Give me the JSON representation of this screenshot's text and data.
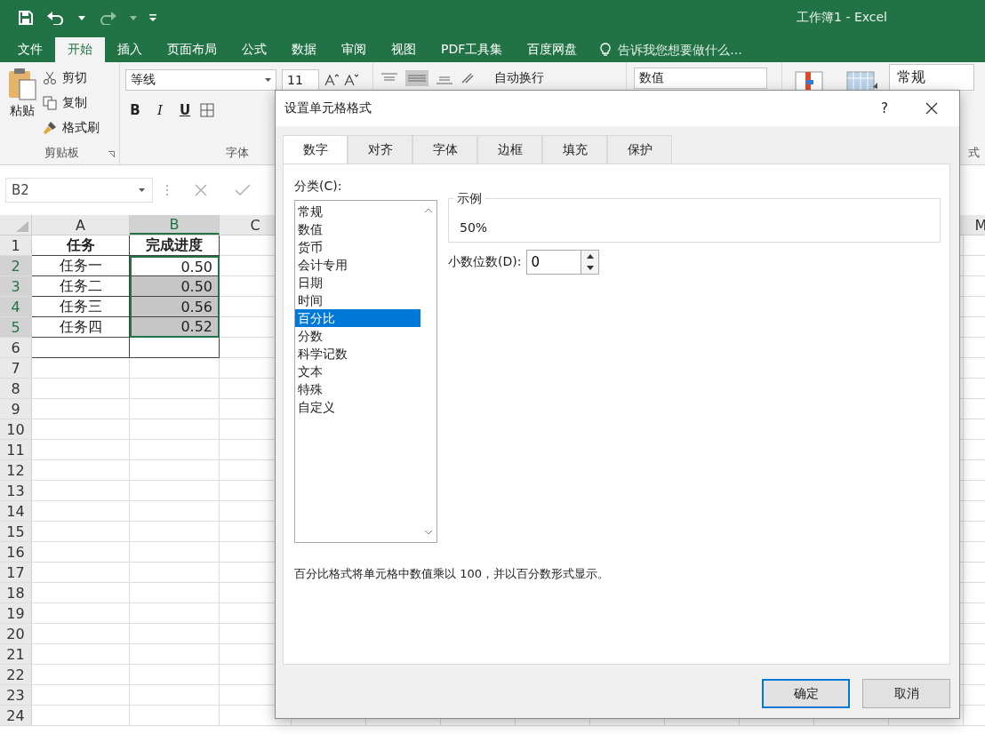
{
  "window": {
    "title": "工作簿1 - Excel"
  },
  "menu_tabs": [
    {
      "label": "文件",
      "selected": false
    },
    {
      "label": "开始",
      "selected": true
    },
    {
      "label": "插入",
      "selected": false
    },
    {
      "label": "页面布局",
      "selected": false
    },
    {
      "label": "公式",
      "selected": false
    },
    {
      "label": "数据",
      "selected": false
    },
    {
      "label": "审阅",
      "selected": false
    },
    {
      "label": "视图",
      "selected": false
    },
    {
      "label": "PDF工具集",
      "selected": false
    },
    {
      "label": "百度网盘",
      "selected": false
    }
  ],
  "tell_me": {
    "placeholder": "告诉我您想要做什么..."
  },
  "ribbon": {
    "paste": "粘贴",
    "cut": "剪切",
    "copy": "复制",
    "format_painter": "格式刷",
    "clipboard_label": "剪贴板",
    "font_name": "等线",
    "font_size": "11",
    "format_buttons": [
      "B",
      "I",
      "U"
    ],
    "font_label": "字体",
    "wrap_text": "自动换行",
    "number_format": "数值",
    "cell_style": "常规",
    "styles_label": "式"
  },
  "formula_bar": {
    "name_box": "B2"
  },
  "sheet": {
    "columns": [
      {
        "label": "A",
        "selected": false
      },
      {
        "label": "B",
        "selected": true
      },
      {
        "label": "C",
        "selected": false
      },
      {
        "label": "M",
        "selected": false
      }
    ],
    "rows": [
      {
        "number": "1",
        "selected": false,
        "bordered": true,
        "cells": [
          {
            "text": "任务",
            "kind": "header",
            "selected": false,
            "active": false
          },
          {
            "text": "完成进度",
            "kind": "header",
            "selected": false,
            "active": false
          }
        ]
      },
      {
        "number": "2",
        "selected": true,
        "bordered": true,
        "cells": [
          {
            "text": "任务一",
            "kind": "text",
            "selected": false,
            "active": false
          },
          {
            "text": "0.50",
            "kind": "number",
            "selected": true,
            "active": true
          }
        ]
      },
      {
        "number": "3",
        "selected": true,
        "bordered": true,
        "cells": [
          {
            "text": "任务二",
            "kind": "text",
            "selected": false,
            "active": false
          },
          {
            "text": "0.50",
            "kind": "number",
            "selected": true,
            "active": false
          }
        ]
      },
      {
        "number": "4",
        "selected": true,
        "bordered": true,
        "cells": [
          {
            "text": "任务三",
            "kind": "text",
            "selected": false,
            "active": false
          },
          {
            "text": "0.56",
            "kind": "number",
            "selected": true,
            "active": false
          }
        ]
      },
      {
        "number": "5",
        "selected": true,
        "bordered": true,
        "cells": [
          {
            "text": "任务四",
            "kind": "text",
            "selected": false,
            "active": false
          },
          {
            "text": "0.52",
            "kind": "number",
            "selected": true,
            "active": false
          }
        ]
      },
      {
        "number": "6",
        "selected": false,
        "bordered": true
      },
      {
        "number": "7",
        "selected": false,
        "bordered": false
      },
      {
        "number": "8",
        "selected": false,
        "bordered": false
      },
      {
        "number": "9",
        "selected": false,
        "bordered": false
      },
      {
        "number": "10",
        "selected": false,
        "bordered": false
      },
      {
        "number": "11",
        "selected": false,
        "bordered": false
      },
      {
        "number": "12",
        "selected": false,
        "bordered": false
      },
      {
        "number": "13",
        "selected": false,
        "bordered": false
      },
      {
        "number": "14",
        "selected": false,
        "bordered": false
      },
      {
        "number": "15",
        "selected": false,
        "bordered": false
      },
      {
        "number": "16",
        "selected": false,
        "bordered": false
      },
      {
        "number": "17",
        "selected": false,
        "bordered": false
      },
      {
        "number": "18",
        "selected": false,
        "bordered": false
      },
      {
        "number": "19",
        "selected": false,
        "bordered": false
      },
      {
        "number": "20",
        "selected": false,
        "bordered": false
      },
      {
        "number": "21",
        "selected": false,
        "bordered": false
      },
      {
        "number": "22",
        "selected": false,
        "bordered": false
      },
      {
        "number": "23",
        "selected": false,
        "bordered": false
      },
      {
        "number": "24",
        "selected": false,
        "bordered": false
      }
    ]
  },
  "dialog": {
    "title": "设置单元格格式",
    "help": "?",
    "tabs": [
      {
        "label": "数字",
        "selected": true
      },
      {
        "label": "对齐",
        "selected": false
      },
      {
        "label": "字体",
        "selected": false
      },
      {
        "label": "边框",
        "selected": false
      },
      {
        "label": "填充",
        "selected": false
      },
      {
        "label": "保护",
        "selected": false
      }
    ],
    "category_label": "分类(C):",
    "categories": [
      {
        "label": "常规",
        "selected": false
      },
      {
        "label": "数值",
        "selected": false
      },
      {
        "label": "货币",
        "selected": false
      },
      {
        "label": "会计专用",
        "selected": false
      },
      {
        "label": "日期",
        "selected": false
      },
      {
        "label": "时间",
        "selected": false
      },
      {
        "label": "百分比",
        "selected": true
      },
      {
        "label": "分数",
        "selected": false
      },
      {
        "label": "科学记数",
        "selected": false
      },
      {
        "label": "文本",
        "selected": false
      },
      {
        "label": "特殊",
        "selected": false
      },
      {
        "label": "自定义",
        "selected": false
      }
    ],
    "sample_label": "示例",
    "sample_value": "50%",
    "decimal_label": "小数位数(D):",
    "decimal_value": "0",
    "description": "百分比格式将单元格中数值乘以 100，并以百分数形式显示。",
    "buttons": [
      {
        "label": "确定",
        "default": true
      },
      {
        "label": "取消",
        "default": false
      }
    ]
  }
}
